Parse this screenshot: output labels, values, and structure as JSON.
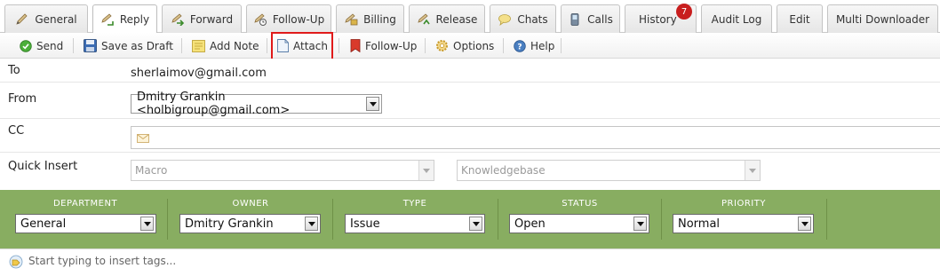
{
  "tabs": [
    {
      "label": "General",
      "icon": "pencil-icon",
      "active": false
    },
    {
      "label": "Reply",
      "icon": "reply-icon",
      "active": true
    },
    {
      "label": "Forward",
      "icon": "forward-icon",
      "active": false
    },
    {
      "label": "Follow-Up",
      "icon": "clock-icon",
      "active": false
    },
    {
      "label": "Billing",
      "icon": "billing-icon",
      "active": false
    },
    {
      "label": "Release",
      "icon": "release-icon",
      "active": false
    },
    {
      "label": "Chats",
      "icon": "chat-bubble-icon",
      "active": false
    },
    {
      "label": "Calls",
      "icon": "phone-icon",
      "active": false
    },
    {
      "label": "History",
      "icon": "",
      "active": false,
      "badge": "7"
    },
    {
      "label": "Audit Log",
      "icon": "",
      "active": false
    },
    {
      "label": "Edit",
      "icon": "",
      "active": false
    },
    {
      "label": "Multi Downloader",
      "icon": "",
      "active": false
    }
  ],
  "toolbar": {
    "send": "Send",
    "save_draft": "Save as Draft",
    "add_note": "Add Note",
    "attach": "Attach",
    "follow_up": "Follow-Up",
    "options": "Options",
    "help": "Help"
  },
  "form": {
    "to_label": "To",
    "to_value": "sherlaimov@gmail.com",
    "from_label": "From",
    "from_value": "Dmitry Grankin <holbigroup@gmail.com>",
    "cc_label": "CC",
    "cc_value": "",
    "quick_insert_label": "Quick Insert",
    "macro_placeholder": "Macro",
    "kb_placeholder": "Knowledgebase"
  },
  "properties": {
    "department": {
      "header": "DEPARTMENT",
      "value": "General"
    },
    "owner": {
      "header": "OWNER",
      "value": "Dmitry Grankin"
    },
    "type": {
      "header": "TYPE",
      "value": "Issue"
    },
    "status": {
      "header": "STATUS",
      "value": "Open"
    },
    "priority": {
      "header": "PRIORITY",
      "value": "Normal"
    }
  },
  "tags": {
    "placeholder": "Start typing to insert tags..."
  },
  "colors": {
    "properties_bar": "#88ad61",
    "attach_highlight": "#e01a1a",
    "badge": "#c81e1e"
  }
}
